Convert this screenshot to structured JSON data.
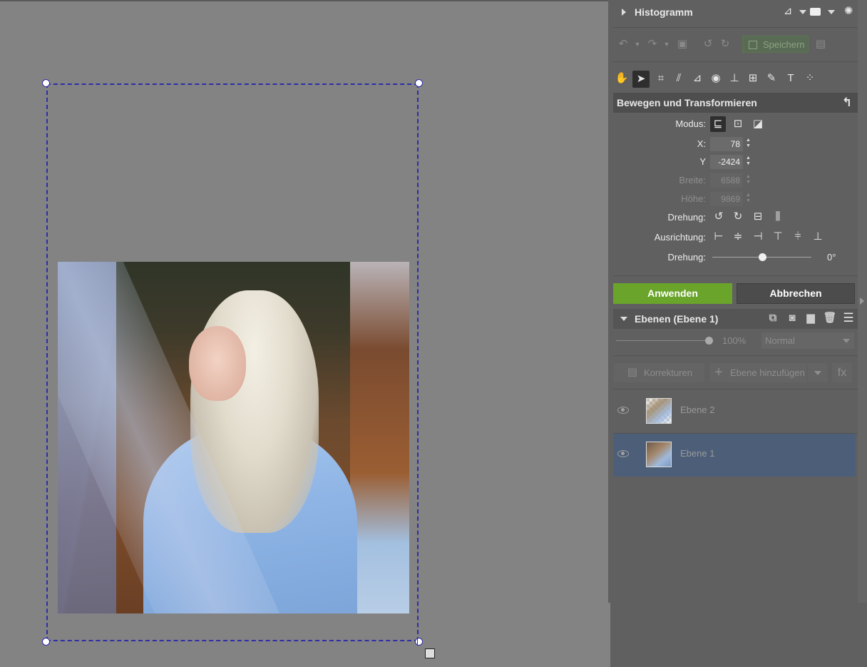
{
  "colors": {
    "panel": "#606060",
    "canvas": "#838383",
    "apply": "#6aa42a",
    "selection": "#2d2da8",
    "selected_layer": "#4d5e79"
  },
  "histogram": {
    "title": "Histogramm"
  },
  "toolbar": {
    "save_label": "Speichern"
  },
  "tools": [
    "hand-icon",
    "pointer-icon",
    "crop-icon",
    "perspective-icon",
    "selection-icon",
    "eye-icon",
    "level-icon",
    "grid-icon",
    "brush-icon",
    "text-icon",
    "dots-icon"
  ],
  "transform": {
    "title": "Bewegen und Transformieren",
    "mode_label": "Modus:",
    "x_label": "X:",
    "x_value": "78",
    "y_label": "Y",
    "y_value": "-2424",
    "width_label": "Breite:",
    "width_value": "6588",
    "height_label": "Höhe:",
    "height_value": "9869",
    "rotation_label": "Drehung:",
    "align_label": "Ausrichtung:",
    "angle_label": "Drehung:",
    "angle_value": "0°",
    "angle_level": 0.5
  },
  "actions": {
    "apply": "Anwenden",
    "cancel": "Abbrechen"
  },
  "layers": {
    "title": "Ebenen (Ebene 1)",
    "opacity": "100%",
    "blend_mode": "Normal",
    "adjustments_label": "Korrekturen",
    "add_layer_label": "Ebene hinzufügen",
    "fx_label": "fx",
    "items": [
      {
        "name": "Ebene 2",
        "selected": false
      },
      {
        "name": "Ebene 1",
        "selected": true
      }
    ]
  }
}
